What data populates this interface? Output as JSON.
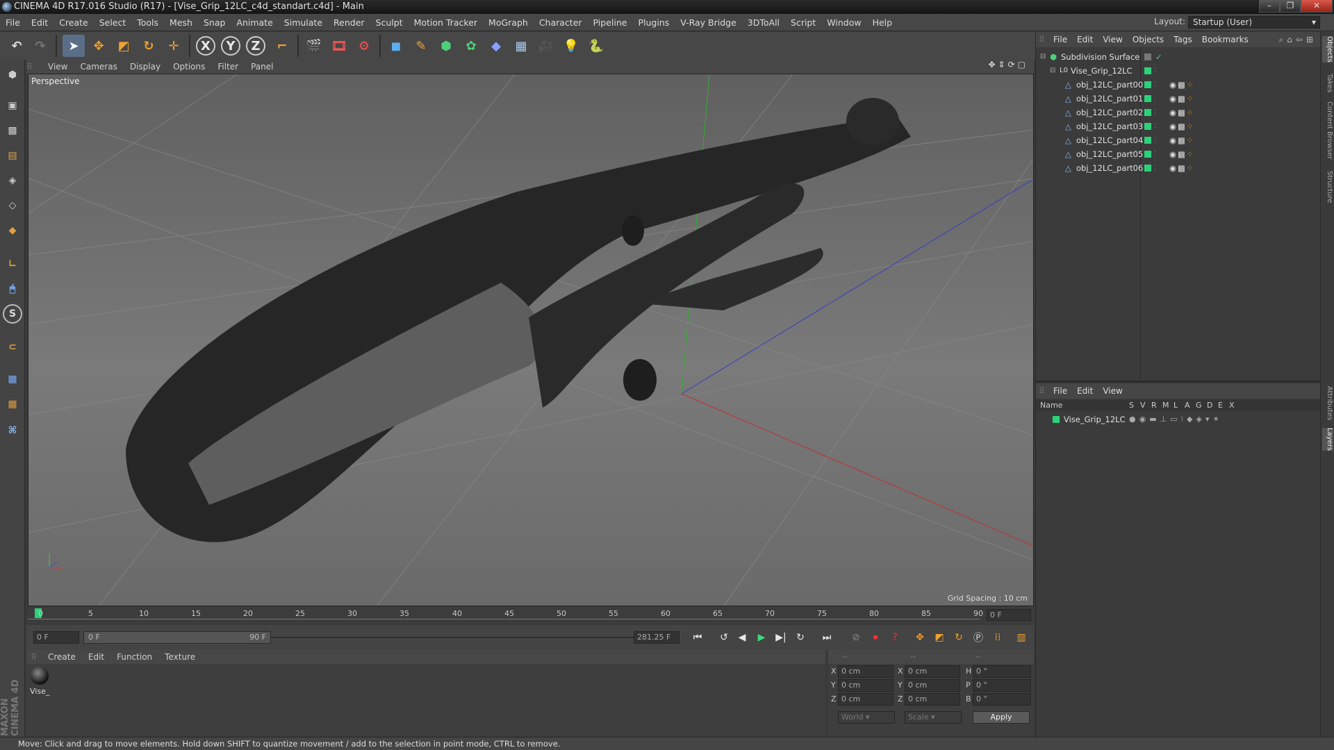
{
  "window": {
    "title": "CINEMA 4D R17.016 Studio (R17) - [Vise_Grip_12LC_c4d_standart.c4d] - Main",
    "minimize": "–",
    "maximize": "❐",
    "close": "✕"
  },
  "menubar": [
    "File",
    "Edit",
    "Create",
    "Select",
    "Tools",
    "Mesh",
    "Snap",
    "Animate",
    "Simulate",
    "Render",
    "Sculpt",
    "Motion Tracker",
    "MoGraph",
    "Character",
    "Pipeline",
    "Plugins",
    "V-Ray Bridge",
    "3DToAll",
    "Script",
    "Window",
    "Help"
  ],
  "layout": {
    "label": "Layout:",
    "value": "Startup (User)"
  },
  "toolbar": {
    "x_label": "X",
    "y_label": "Y",
    "z_label": "Z"
  },
  "viewport": {
    "menu": [
      "View",
      "Cameras",
      "Display",
      "Options",
      "Filter",
      "Panel"
    ],
    "label": "Perspective",
    "grid_spacing": "Grid Spacing : 10 cm"
  },
  "timeline": {
    "ticks": [
      "0",
      "5",
      "10",
      "15",
      "20",
      "25",
      "30",
      "35",
      "40",
      "45",
      "50",
      "55",
      "60",
      "65",
      "70",
      "75",
      "80",
      "85",
      "90"
    ],
    "end_field": "0 F"
  },
  "playback": {
    "start": "0 F",
    "range_start": "0 F",
    "range_end": "90 F",
    "current": "281.25 F"
  },
  "material_panel": {
    "menu": [
      "Create",
      "Edit",
      "Function",
      "Texture"
    ],
    "material_name": "Vise_"
  },
  "coords": {
    "headers": [
      "--",
      "--",
      "--"
    ],
    "rows": [
      {
        "a": "X",
        "av": "0 cm",
        "b": "X",
        "bv": "0 cm",
        "c": "H",
        "cv": "0 °"
      },
      {
        "a": "Y",
        "av": "0 cm",
        "b": "Y",
        "bv": "0 cm",
        "c": "P",
        "cv": "0 °"
      },
      {
        "a": "Z",
        "av": "0 cm",
        "b": "Z",
        "bv": "0 cm",
        "c": "B",
        "cv": "0 °"
      }
    ],
    "world": "World",
    "scale": "Scale",
    "apply": "Apply"
  },
  "object_manager": {
    "menu": [
      "File",
      "Edit",
      "View",
      "Objects",
      "Tags",
      "Bookmarks"
    ],
    "items": [
      {
        "name": "Subdivision Surface",
        "indent": 0
      },
      {
        "name": "Vise_Grip_12LC",
        "indent": 1
      },
      {
        "name": "obj_12LC_part00",
        "indent": 2
      },
      {
        "name": "obj_12LC_part01",
        "indent": 2
      },
      {
        "name": "obj_12LC_part02",
        "indent": 2
      },
      {
        "name": "obj_12LC_part03",
        "indent": 2
      },
      {
        "name": "obj_12LC_part04",
        "indent": 2
      },
      {
        "name": "obj_12LC_part05",
        "indent": 2
      },
      {
        "name": "obj_12LC_part06",
        "indent": 2
      }
    ]
  },
  "layer_manager": {
    "menu": [
      "File",
      "Edit",
      "View"
    ],
    "columns": [
      "Name",
      "S",
      "V",
      "R",
      "M",
      "L",
      "A",
      "G",
      "D",
      "E",
      "X"
    ],
    "layer_name": "Vise_Grip_12LC"
  },
  "side_tabs": [
    "Objects",
    "Takes",
    "Content Browser",
    "Structure",
    "Attributes",
    "Layers"
  ],
  "status": "Move: Click and drag to move elements. Hold down SHIFT to quantize movement / add to the selection in point mode, CTRL to remove.",
  "brand": "MAXON CINEMA 4D"
}
